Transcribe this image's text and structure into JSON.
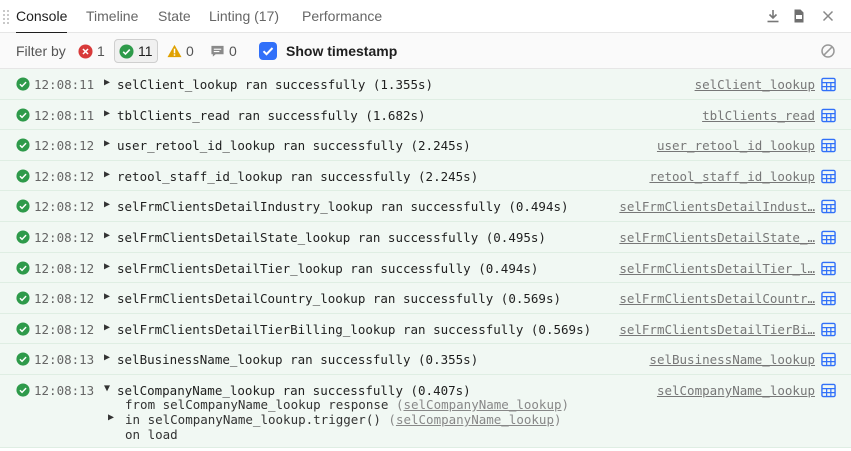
{
  "tabs": [
    {
      "label": "Console",
      "active": true
    },
    {
      "label": "Timeline",
      "active": false
    },
    {
      "label": "State",
      "active": false
    },
    {
      "label": "Linting (17)",
      "active": false
    },
    {
      "label": "Performance",
      "active": false
    }
  ],
  "toolbar_icons": [
    "download-icon",
    "pdf-icon",
    "close-icon"
  ],
  "filter": {
    "label": "Filter by",
    "errors": "1",
    "success": "11",
    "warnings": "0",
    "messages": "0",
    "show_timestamp": "Show timestamp",
    "show_timestamp_checked": true
  },
  "colors": {
    "accent": "#3170f9",
    "success": "#2e9a4a",
    "error": "#d83a3a",
    "warning": "#e0a100",
    "row_bg": "#f1f8f3",
    "link_blue": "#3170f9"
  },
  "entries": [
    {
      "time": "12:08:11",
      "caret": "▶",
      "message": "selClient_lookup ran successfully (1.355s)",
      "source": "selClient_lookup"
    },
    {
      "time": "12:08:11",
      "caret": "▶",
      "message": "tblClients_read ran successfully (1.682s)",
      "source": "tblClients_read"
    },
    {
      "time": "12:08:12",
      "caret": "▶",
      "message": "user_retool_id_lookup ran successfully (2.245s)",
      "source": "user_retool_id_lookup"
    },
    {
      "time": "12:08:12",
      "caret": "▶",
      "message": "retool_staff_id_lookup ran successfully (2.245s)",
      "source": "retool_staff_id_lookup"
    },
    {
      "time": "12:08:12",
      "caret": "▶",
      "message": "selFrmClientsDetailIndustry_lookup ran successfully (0.494s)",
      "source": "selFrmClientsDetailIndust…"
    },
    {
      "time": "12:08:12",
      "caret": "▶",
      "message": "selFrmClientsDetailState_lookup ran successfully (0.495s)",
      "source": "selFrmClientsDetailState_…"
    },
    {
      "time": "12:08:12",
      "caret": "▶",
      "message": "selFrmClientsDetailTier_lookup ran successfully (0.494s)",
      "source": "selFrmClientsDetailTier_l…"
    },
    {
      "time": "12:08:12",
      "caret": "▶",
      "message": "selFrmClientsDetailCountry_lookup ran successfully (0.569s)",
      "source": "selFrmClientsDetailCountr…"
    },
    {
      "time": "12:08:12",
      "caret": "▶",
      "message": "selFrmClientsDetailTierBilling_lookup ran successfully (0.569s)",
      "source": "selFrmClientsDetailTierBi…"
    },
    {
      "time": "12:08:13",
      "caret": "▶",
      "message": "selBusinessName_lookup ran successfully (0.355s)",
      "source": "selBusinessName_lookup"
    },
    {
      "time": "12:08:13",
      "caret": "▼",
      "message": "selCompanyName_lookup ran successfully (0.407s)",
      "source": "selCompanyName_lookup",
      "details": {
        "from_text": "from selCompanyName_lookup response",
        "from_link": "selCompanyName_lookup",
        "in_caret": "▶",
        "in_text": "in selCompanyName_lookup.trigger()",
        "in_link": "selCompanyName_lookup",
        "on_text": "on load"
      }
    }
  ]
}
